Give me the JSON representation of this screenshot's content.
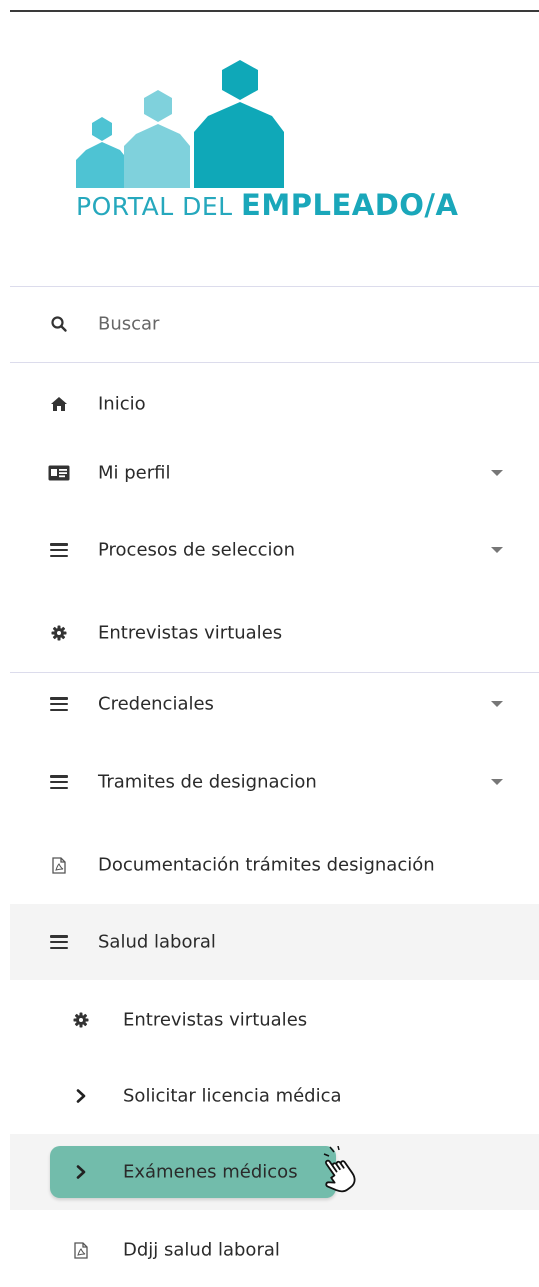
{
  "brand": {
    "title_light": "PORTAL DEL ",
    "title_bold": "EMPLEADO/A",
    "colors": {
      "primary": "#1aa7ba",
      "light": "#7fd1dc",
      "dark": "#0f9aa8"
    }
  },
  "search": {
    "label": "Buscar",
    "icon": "search-icon"
  },
  "menu": [
    {
      "label": "Inicio",
      "icon": "home-icon"
    },
    {
      "label": "Mi perfil",
      "icon": "id-card-icon",
      "expandable": true
    },
    {
      "label": "Procesos de seleccion",
      "icon": "menu-icon",
      "expandable": true
    },
    {
      "label": "Entrevistas virtuales",
      "icon": "gear-icon"
    },
    {
      "label": "Credenciales",
      "icon": "menu-icon",
      "expandable": true
    },
    {
      "label": "Tramites de designacion",
      "icon": "menu-icon",
      "expandable": true
    },
    {
      "label": "Documentación trámites designación",
      "icon": "pdf-icon"
    },
    {
      "label": "Salud laboral",
      "icon": "menu-icon",
      "expanded": true
    }
  ],
  "submenu": [
    {
      "label": "Entrevistas virtuales",
      "icon": "gear-icon"
    },
    {
      "label": "Solicitar licencia médica",
      "icon": "chevron-right-icon"
    },
    {
      "label": "Exámenes médicos",
      "icon": "chevron-right-icon",
      "highlighted": true,
      "highlight_color": "#72bcab"
    },
    {
      "label": "Ddjj salud laboral",
      "icon": "pdf-icon"
    }
  ]
}
